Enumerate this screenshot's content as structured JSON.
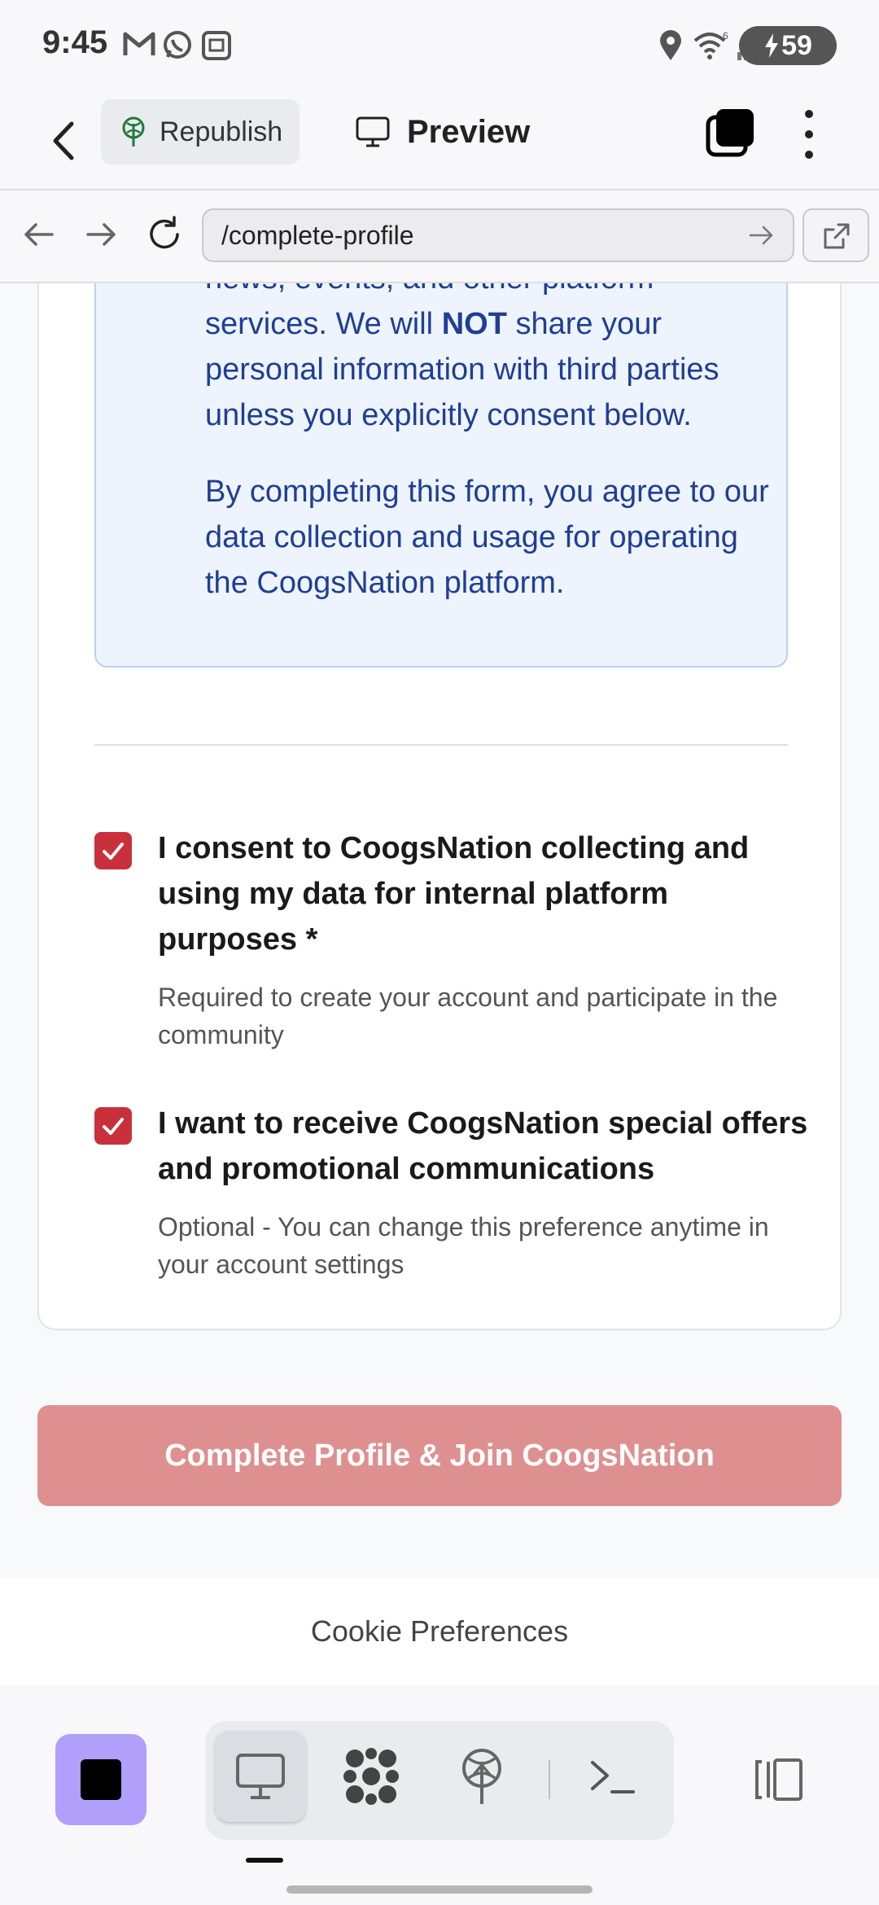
{
  "status_bar": {
    "time": "9:45",
    "battery": "59",
    "icons": [
      "gmail-icon",
      "whatsapp-icon",
      "screenshot-icon",
      "location-icon",
      "wifi-icon",
      "signal-icon",
      "charging-icon"
    ]
  },
  "app_bar": {
    "republish_label": "Republish",
    "preview_label": "Preview"
  },
  "url_bar": {
    "url": "/complete-profile"
  },
  "info_box": {
    "p1_text1": "news, events, and other platform services. We will ",
    "p1_bold": "NOT",
    "p1_text2": " share your personal information with third parties unless you explicitly consent below.",
    "p2": "By completing this form, you agree to our data collection and usage for operating the CoogsNation platform."
  },
  "consent": {
    "internal": {
      "label": "I consent to CoogsNation collecting and using my data for internal platform purposes *",
      "help": "Required to create your account and participate in the community",
      "checked": true
    },
    "promo": {
      "label": "I want to receive CoogsNation special offers and promotional communications",
      "help": "Optional - You can change this preference anytime in your account settings",
      "checked": true
    }
  },
  "submit_label": "Complete Profile & Join CoogsNation",
  "footer": {
    "cookie_label": "Cookie Preferences"
  },
  "colors": {
    "accent": "#c9303c",
    "submit_disabled": "#de9090",
    "info_text": "#1f3e96",
    "info_bg": "#eef4fd",
    "stop_button": "#b09ffb"
  }
}
